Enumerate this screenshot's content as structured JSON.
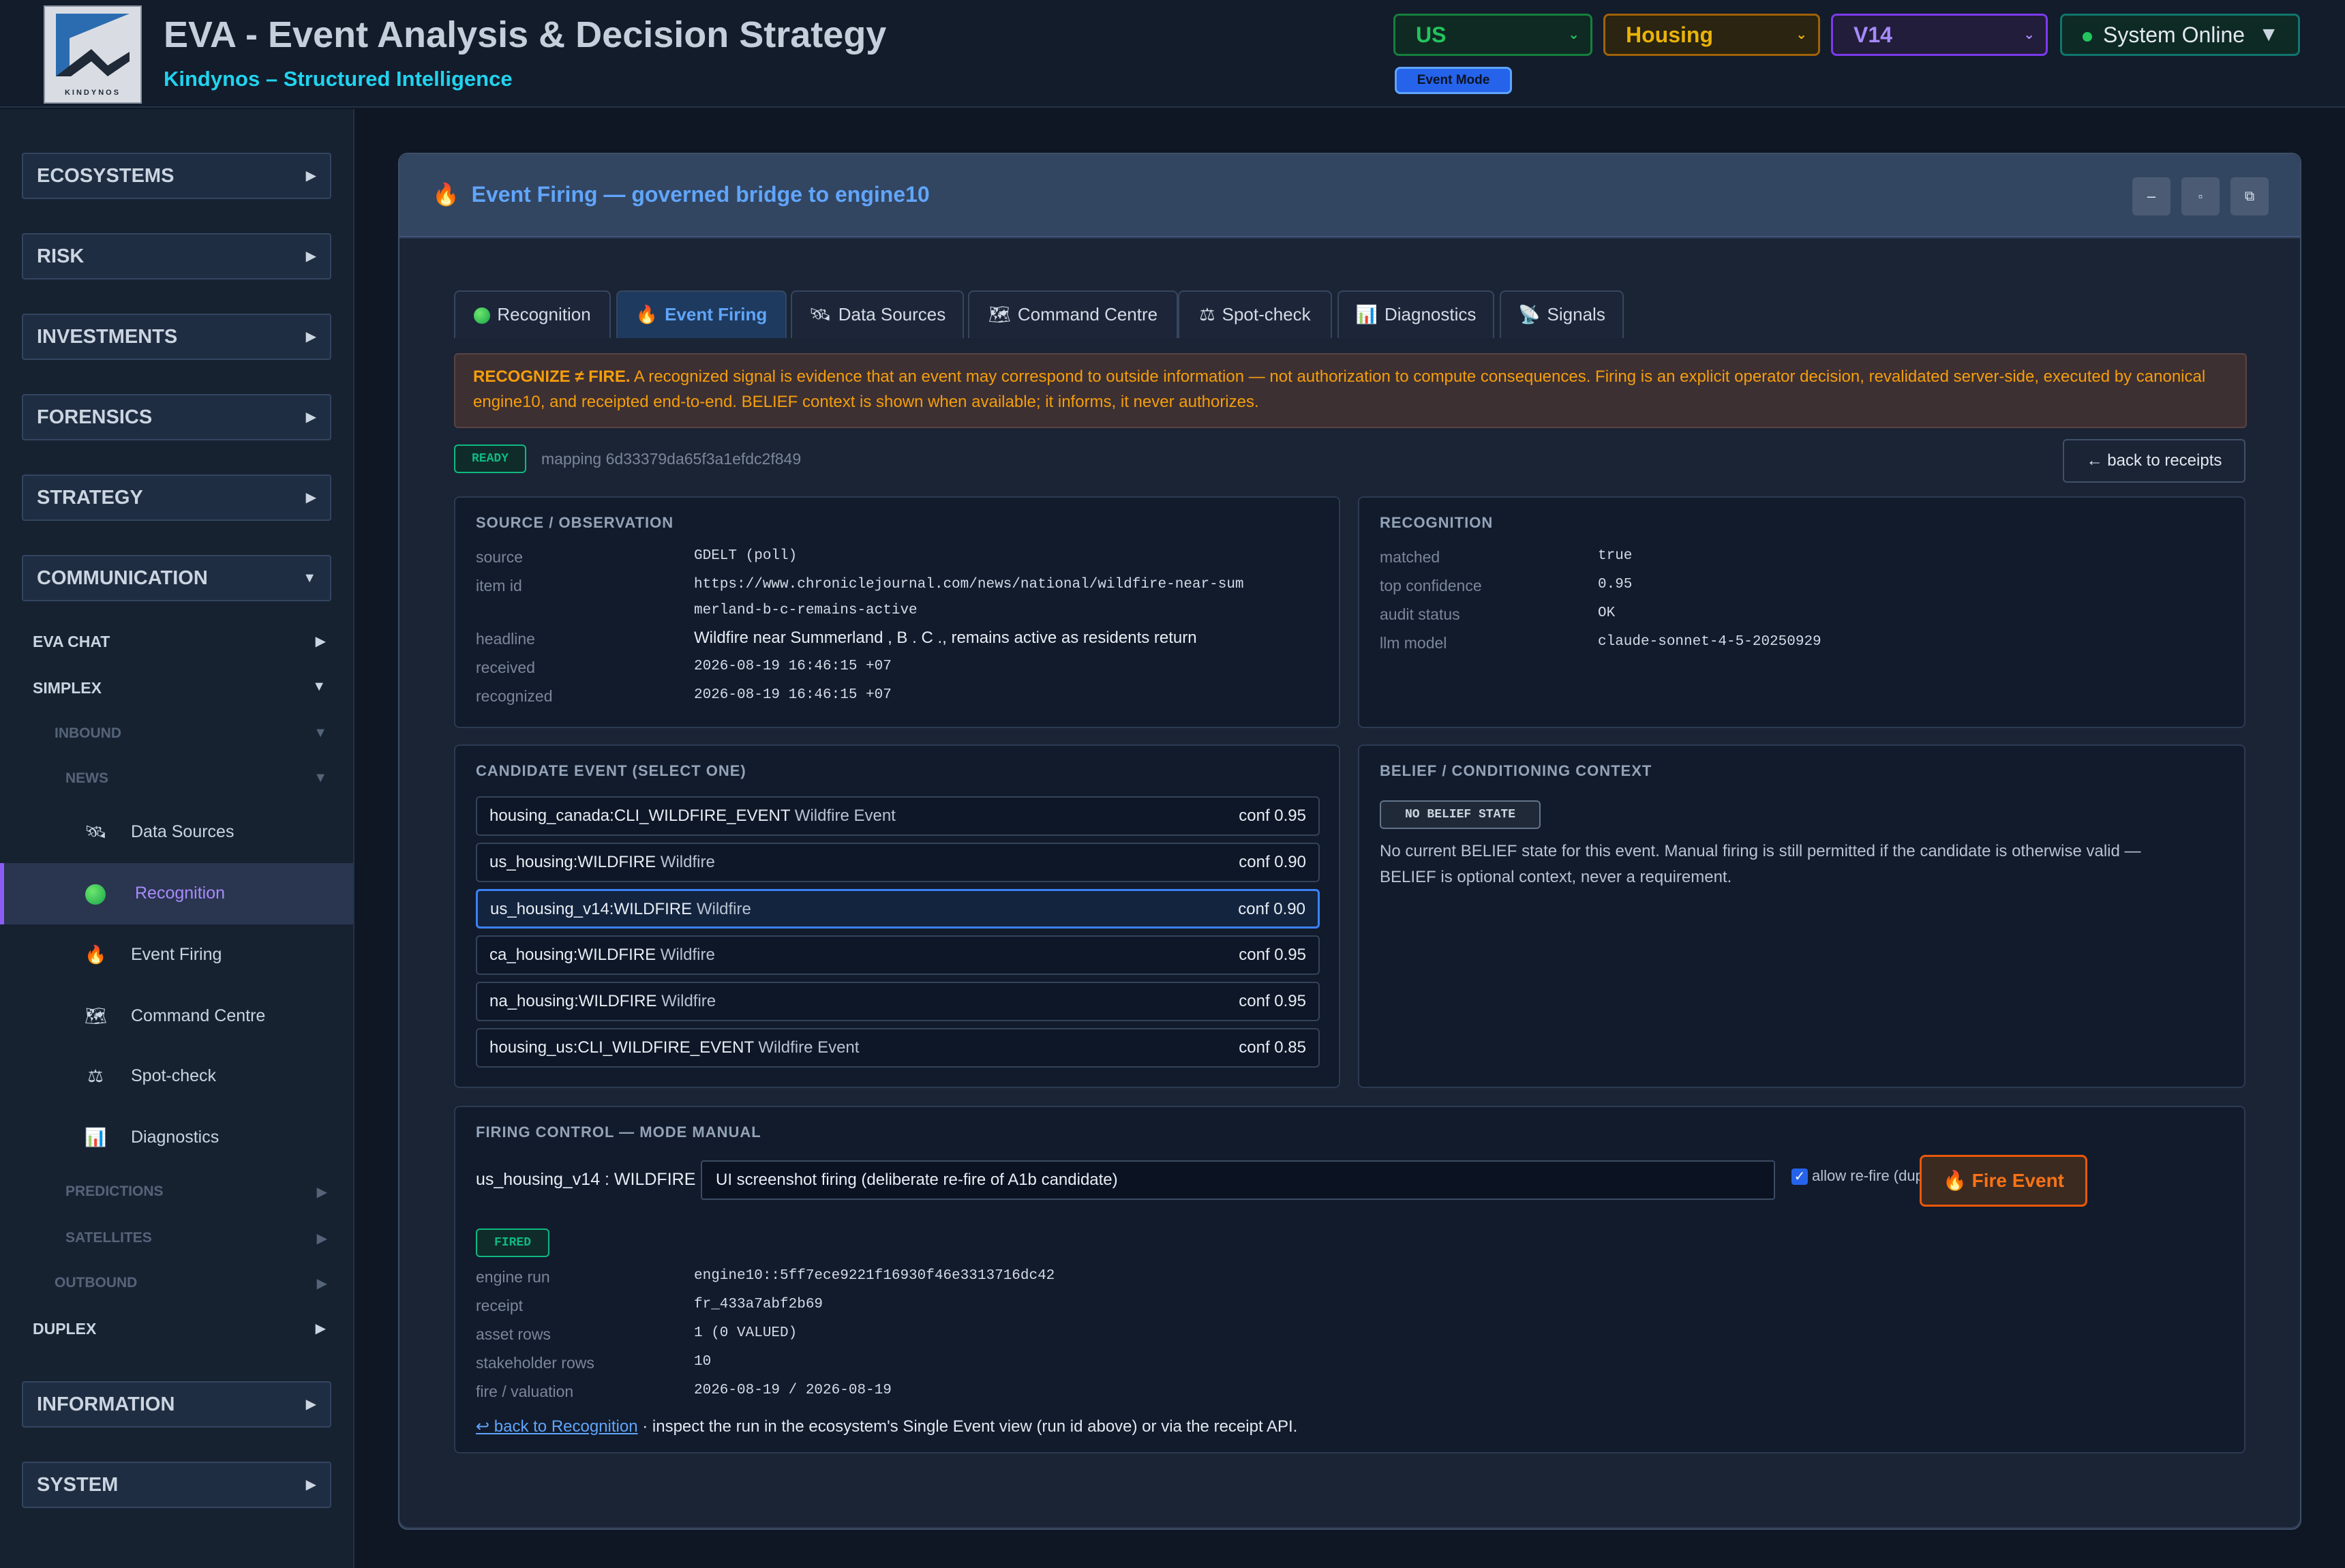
{
  "header": {
    "title": "EVA - Event Analysis & Decision Strategy",
    "subtitle": "Kindynos – Structured Intelligence",
    "logo_text": "KINDYNOS",
    "country": "US",
    "sector": "Housing",
    "version": "V14",
    "status": "System Online",
    "mode": "Event Mode"
  },
  "sidebar": {
    "sections": [
      "ECOSYSTEMS",
      "RISK",
      "INVESTMENTS",
      "FORENSICS",
      "STRATEGY",
      "COMMUNICATION",
      "INFORMATION",
      "SYSTEM"
    ],
    "eva_chat": "EVA CHAT",
    "simplex": "SIMPLEX",
    "inbound": "INBOUND",
    "news": "NEWS",
    "news_items": [
      "Data Sources",
      "Recognition",
      "Event Firing",
      "Command Centre",
      "Spot-check",
      "Diagnostics"
    ],
    "predictions": "PREDICTIONS",
    "satellites": "SATELLITES",
    "outbound": "OUTBOUND",
    "duplex": "DUPLEX"
  },
  "panel": {
    "title": "Event Firing — governed bridge to engine10",
    "window_buttons": [
      "–",
      "▫",
      "⧉"
    ]
  },
  "tabs": [
    "Recognition",
    "Event Firing",
    "Data Sources",
    "Command Centre",
    "Spot-check",
    "Diagnostics",
    "Signals"
  ],
  "notice": {
    "lead": "RECOGNIZE ≠ FIRE.",
    "text": " A recognized signal is evidence that an event may correspond to outside information — not authorization to compute consequences. Firing is an explicit operator decision, revalidated server-side, executed by canonical engine10, and receipted end-to-end. BELIEF context is shown when available; it informs, it never authorizes."
  },
  "status_badge": "READY",
  "mapping": "mapping 6d33379da65f3a1efdc2f849",
  "back_to_receipts": "← back to receipts",
  "source": {
    "title": "SOURCE / OBSERVATION",
    "labels": [
      "source",
      "item id",
      "headline",
      "received",
      "recognized"
    ],
    "source": "GDELT (poll)",
    "item_id_1": "https://www.chroniclejournal.com/news/national/wildfire-near-sum",
    "item_id_2": "merland-b-c-remains-active",
    "headline": "Wildfire near Summerland , B . C ., remains active as residents return",
    "received": "2026-08-19 16:46:15 +07",
    "recognized": "2026-08-19 16:46:15 +07"
  },
  "recognition": {
    "title": "RECOGNITION",
    "labels": [
      "matched",
      "top confidence",
      "audit status",
      "llm model"
    ],
    "values": [
      "true",
      "0.95",
      "OK",
      "claude-sonnet-4-5-20250929"
    ]
  },
  "candidates": {
    "title": "CANDIDATE EVENT (SELECT ONE)",
    "items": [
      {
        "code": "housing_canada:CLI_WILDFIRE_EVENT",
        "name": "Wildfire Event",
        "conf": "conf 0.95"
      },
      {
        "code": "us_housing:WILDFIRE",
        "name": "Wildfire",
        "conf": "conf 0.90"
      },
      {
        "code": "us_housing_v14:WILDFIRE",
        "name": "Wildfire",
        "conf": "conf 0.90"
      },
      {
        "code": "ca_housing:WILDFIRE",
        "name": "Wildfire",
        "conf": "conf 0.95"
      },
      {
        "code": "na_housing:WILDFIRE",
        "name": "Wildfire",
        "conf": "conf 0.95"
      },
      {
        "code": "housing_us:CLI_WILDFIRE_EVENT",
        "name": "Wildfire Event",
        "conf": "conf 0.85"
      }
    ]
  },
  "belief": {
    "title": "BELIEF / CONDITIONING CONTEXT",
    "badge": "NO BELIEF STATE",
    "text_1": "No current BELIEF state for this event. Manual firing is still permitted if the candidate is otherwise valid —",
    "text_2": "BELIEF is optional context, never a requirement."
  },
  "firing": {
    "title": "FIRING CONTROL — MODE MANUAL",
    "target": "us_housing_v14 : WILDFIRE",
    "note": "UI screenshot firing (deliberate re-fire of A1b candidate)",
    "refire_label": "allow re-fire (duplicate override)",
    "fire_button": "Fire Event",
    "result_badge": "FIRED",
    "labels": [
      "engine run",
      "receipt",
      "asset rows",
      "stakeholder rows",
      "fire / valuation"
    ],
    "values": [
      "engine10::5ff7ece9221f16930f46e3313716dc42",
      "fr_433a7abf2b69",
      "1 (0 VALUED)",
      "10",
      "2026-08-19 / 2026-08-19"
    ],
    "back_link": "↩ back to Recognition",
    "footer_text": " · inspect the run in the ecosystem's Single Event view (run id above) or via the receipt API."
  },
  "colors": {
    "accent": "#60a5fa",
    "warning": "#f59e0b",
    "success": "#10b981",
    "fire": "#f97316"
  }
}
